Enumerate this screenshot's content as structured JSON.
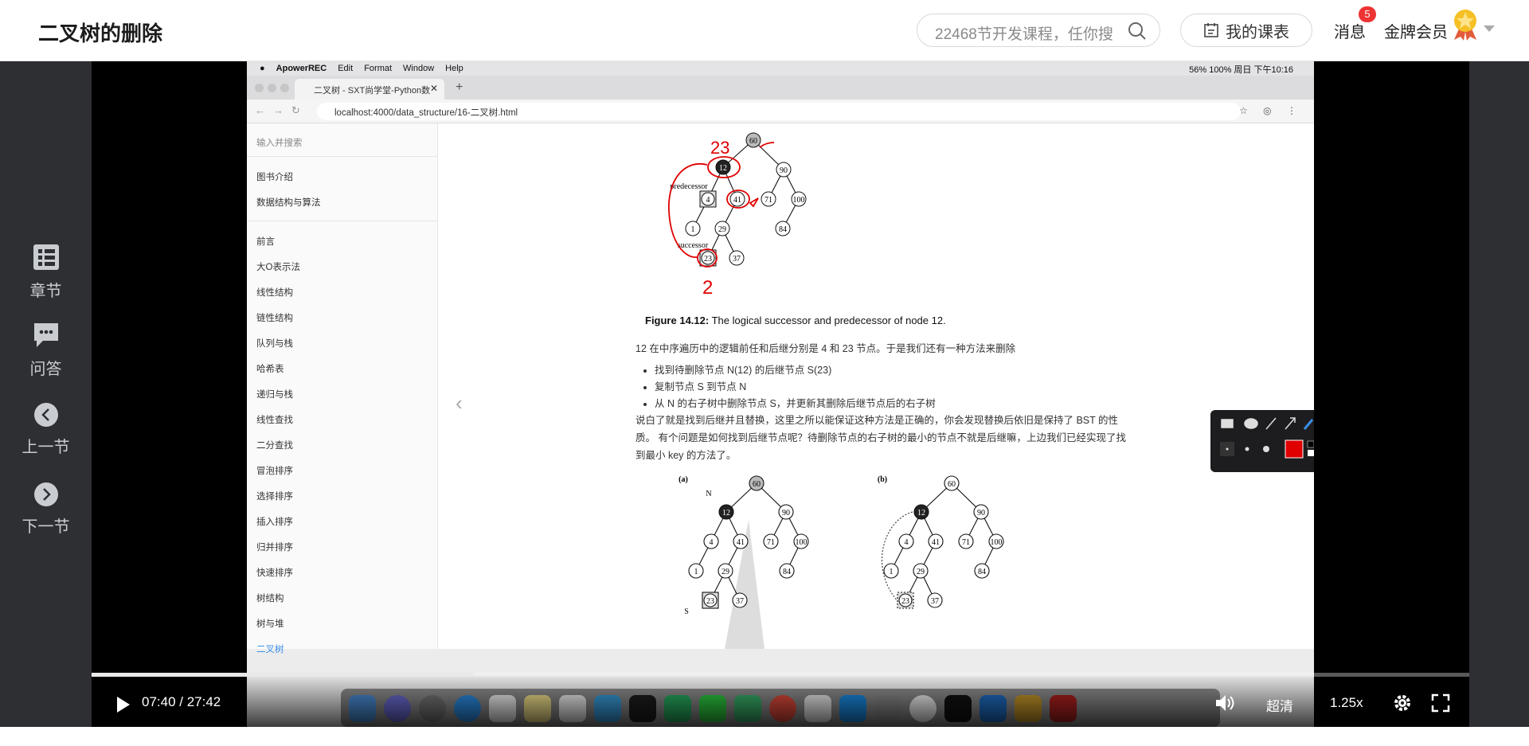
{
  "header": {
    "course_title": "二叉树的删除",
    "search_placeholder": "22468节开发课程，任你搜",
    "schedule_label": "我的课表",
    "messages_label": "消息",
    "messages_count": "5",
    "membership_label": "金牌会员"
  },
  "left_rail": {
    "chapters": "章节",
    "qa": "问答",
    "prev": "上一节",
    "next": "下一节"
  },
  "video": {
    "mac_menu": [
      "ApowerREC",
      "Edit",
      "Format",
      "Window",
      "Help"
    ],
    "mac_status": "56%   100%   周日 下午10:16",
    "tab_title": "二叉树 - SXT尚学堂-Python数",
    "url": "localhost:4000/data_structure/16-二叉树.html",
    "sidebar": {
      "search_placeholder": "输入并搜索",
      "group1": [
        "图书介绍",
        "数据结构与算法"
      ],
      "group2": [
        "前言",
        "大O表示法",
        "线性结构",
        "链性结构",
        "队列与栈",
        "哈希表",
        "递归与栈",
        "线性查找",
        "二分查找",
        "冒泡排序",
        "选择排序",
        "插入排序",
        "归并排序",
        "快速排序",
        "树结构",
        "树与堆",
        "二叉树"
      ],
      "active": "二叉树"
    },
    "doc": {
      "figure_caption_bold": "Figure 14.12:",
      "figure_caption": " The logical successor and predecessor of node 12.",
      "para1": "12 在中序遍历中的逻辑前任和后继分别是 4 和 23 节点。于是我们还有一种方法来删除",
      "bullets": [
        "找到待删除节点 N(12) 的后继节点 S(23)",
        "复制节点 S 到节点 N",
        "从 N 的右子树中删除节点 S，并更新其删除后继节点后的右子树"
      ],
      "para2": "说白了就是找到后继并且替换，这里之所以能保证这种方法是正确的，你会发现替换后依旧是保持了 BST 的性质。 有个问题是如何找到后继节点呢？待删除节点的右子树的最小的节点不就是后继嘛，上边我们已经实现了找到最小 key 的方法了。",
      "tree_top": {
        "labels": [
          "predecessor",
          "successor"
        ],
        "nodes": [
          "60",
          "12",
          "90",
          "4",
          "41",
          "71",
          "100",
          "1",
          "29",
          "84",
          "23",
          "37"
        ],
        "annotations": [
          "23",
          "2"
        ]
      },
      "tree_a": {
        "tag": "(a)",
        "labels": [
          "N",
          "S"
        ],
        "nodes": [
          "60",
          "12",
          "90",
          "4",
          "41",
          "71",
          "100",
          "1",
          "29",
          "84",
          "23",
          "37"
        ]
      },
      "tree_b": {
        "tag": "(b)",
        "nodes": [
          "60",
          "12",
          "90",
          "4",
          "41",
          "71",
          "100",
          "1",
          "29",
          "84",
          "23",
          "37"
        ]
      }
    }
  },
  "controls": {
    "time": "07:40 / 27:42",
    "progress": 0.277,
    "quality": "超清",
    "speed": "1.25x"
  },
  "colors": {
    "accent": "#3b8ee6",
    "annotation_red": "#e00000",
    "badge": "#e33333"
  }
}
